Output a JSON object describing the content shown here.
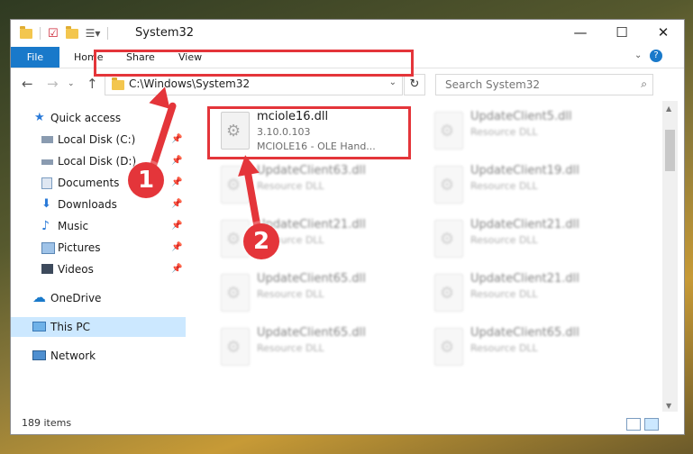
{
  "title_bar": {
    "title": "System32"
  },
  "ribbon": {
    "tabs": [
      "File",
      "Home",
      "Share",
      "View"
    ]
  },
  "address": {
    "path": "C:\\Windows\\System32",
    "search_placeholder": "Search System32"
  },
  "sidebar": {
    "items": [
      {
        "label": "Quick access"
      },
      {
        "label": "Local Disk (C:)"
      },
      {
        "label": "Local Disk (D:)"
      },
      {
        "label": "Documents"
      },
      {
        "label": "Downloads"
      },
      {
        "label": "Music"
      },
      {
        "label": "Pictures"
      },
      {
        "label": "Videos"
      },
      {
        "label": "OneDrive"
      },
      {
        "label": "This PC"
      },
      {
        "label": "Network"
      }
    ]
  },
  "files": [
    {
      "name": "mciole16.dll",
      "line1": "3.10.0.103",
      "line2": "MCIOLE16 - OLE Hand..."
    },
    {
      "name": "UpdateClient5.dll",
      "line1": "Resource DLL"
    },
    {
      "name": "UpdateClient63.dll",
      "line1": "Resource DLL"
    },
    {
      "name": "UpdateClient19.dll",
      "line1": "Resource DLL"
    },
    {
      "name": "UpdateClient21.dll",
      "line1": "Resource DLL"
    },
    {
      "name": "UpdateClient21.dll",
      "line1": "Resource DLL"
    },
    {
      "name": "UpdateClient65.dll",
      "line1": "Resource DLL"
    },
    {
      "name": "UpdateClient21.dll",
      "line1": "Resource DLL"
    },
    {
      "name": "UpdateClient65.dll",
      "line1": "Resource DLL"
    },
    {
      "name": "UpdateClient65.dll",
      "line1": "Resource DLL"
    }
  ],
  "status": {
    "item_count": "189 items"
  },
  "annotations": {
    "step1": "1",
    "step2": "2"
  },
  "colors": {
    "accent": "#1979ca",
    "highlight": "#e4353a",
    "selected": "#cce8ff"
  }
}
